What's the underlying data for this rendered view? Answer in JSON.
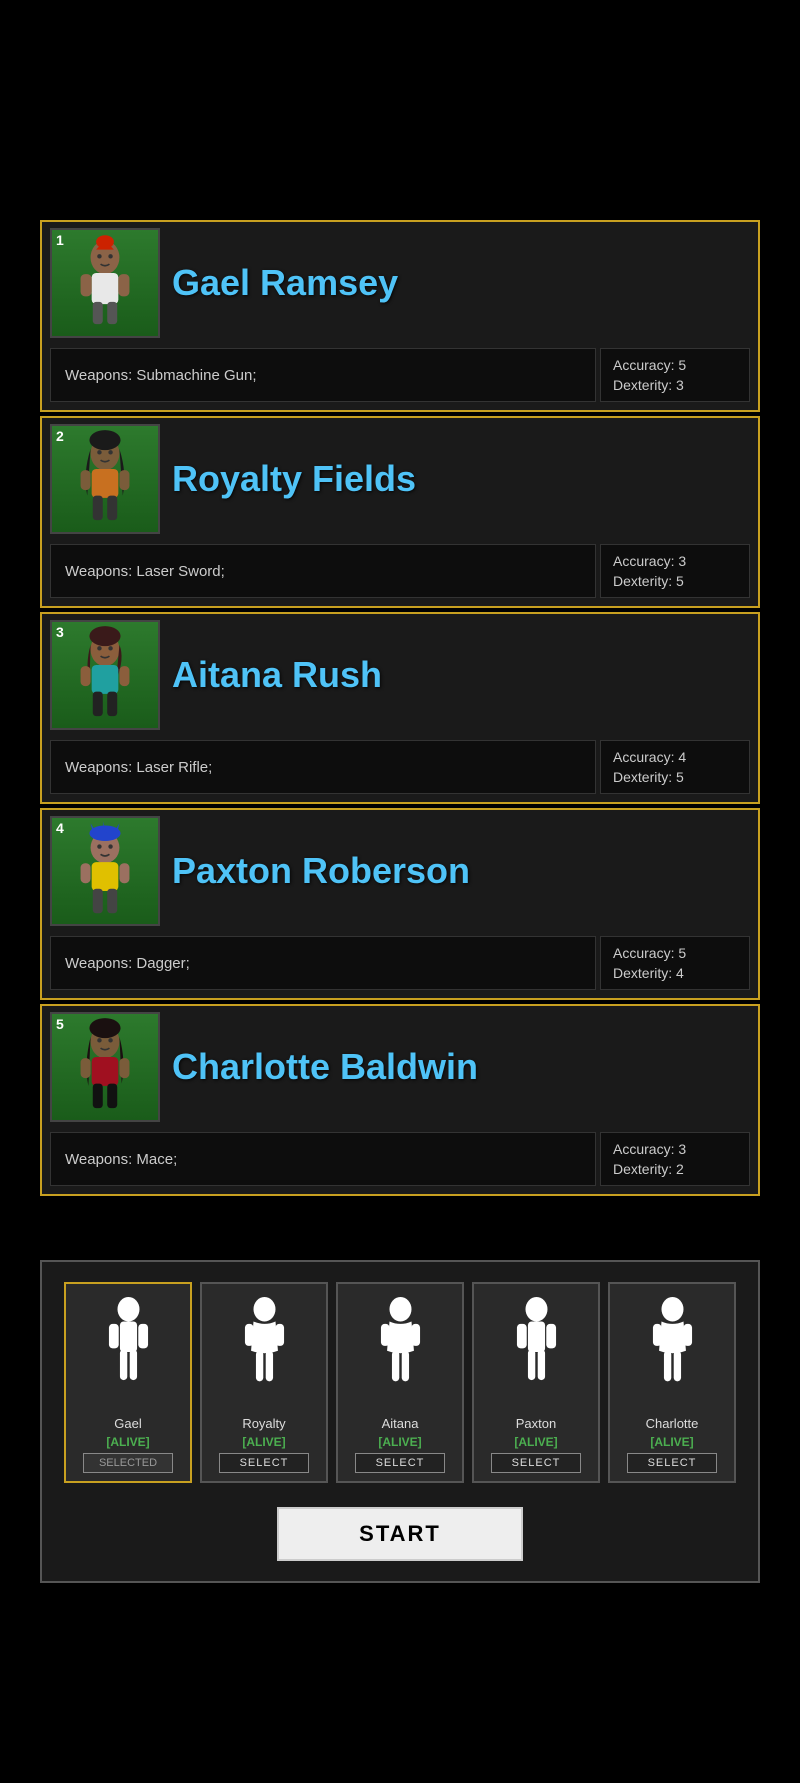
{
  "topSpacer": 220,
  "characters": [
    {
      "id": 1,
      "name": "Gael Ramsey",
      "weapons": "Weapons: Submachine Gun;",
      "accuracy": "Accuracy: 5",
      "dexterity": "Dexterity: 3",
      "portraitClass": "portrait-1",
      "gender": "male"
    },
    {
      "id": 2,
      "name": "Royalty Fields",
      "weapons": "Weapons: Laser Sword;",
      "accuracy": "Accuracy: 3",
      "dexterity": "Dexterity: 5",
      "portraitClass": "portrait-2",
      "gender": "female"
    },
    {
      "id": 3,
      "name": "Aitana Rush",
      "weapons": "Weapons: Laser Rifle;",
      "accuracy": "Accuracy: 4",
      "dexterity": "Dexterity: 5",
      "portraitClass": "portrait-3",
      "gender": "female"
    },
    {
      "id": 4,
      "name": "Paxton Roberson",
      "weapons": "Weapons: Dagger;",
      "accuracy": "Accuracy: 5",
      "dexterity": "Dexterity: 4",
      "portraitClass": "portrait-4",
      "gender": "male"
    },
    {
      "id": 5,
      "name": "Charlotte Baldwin",
      "weapons": "Weapons: Mace;",
      "accuracy": "Accuracy: 3",
      "dexterity": "Dexterity: 2",
      "portraitClass": "portrait-5",
      "gender": "female"
    }
  ],
  "playerCards": [
    {
      "name": "Gael",
      "status": "[ALIVE]",
      "selected": true,
      "selectLabel": "SELECTED"
    },
    {
      "name": "Royalty",
      "status": "[ALIVE]",
      "selected": false,
      "selectLabel": "SELECT"
    },
    {
      "name": "Aitana",
      "status": "[ALIVE]",
      "selected": false,
      "selectLabel": "SELECT"
    },
    {
      "name": "Paxton",
      "status": "[ALIVE]",
      "selected": false,
      "selectLabel": "SELECT"
    },
    {
      "name": "Charlotte",
      "status": "[ALIVE]",
      "selected": false,
      "selectLabel": "SELECT"
    }
  ],
  "startButton": "START"
}
